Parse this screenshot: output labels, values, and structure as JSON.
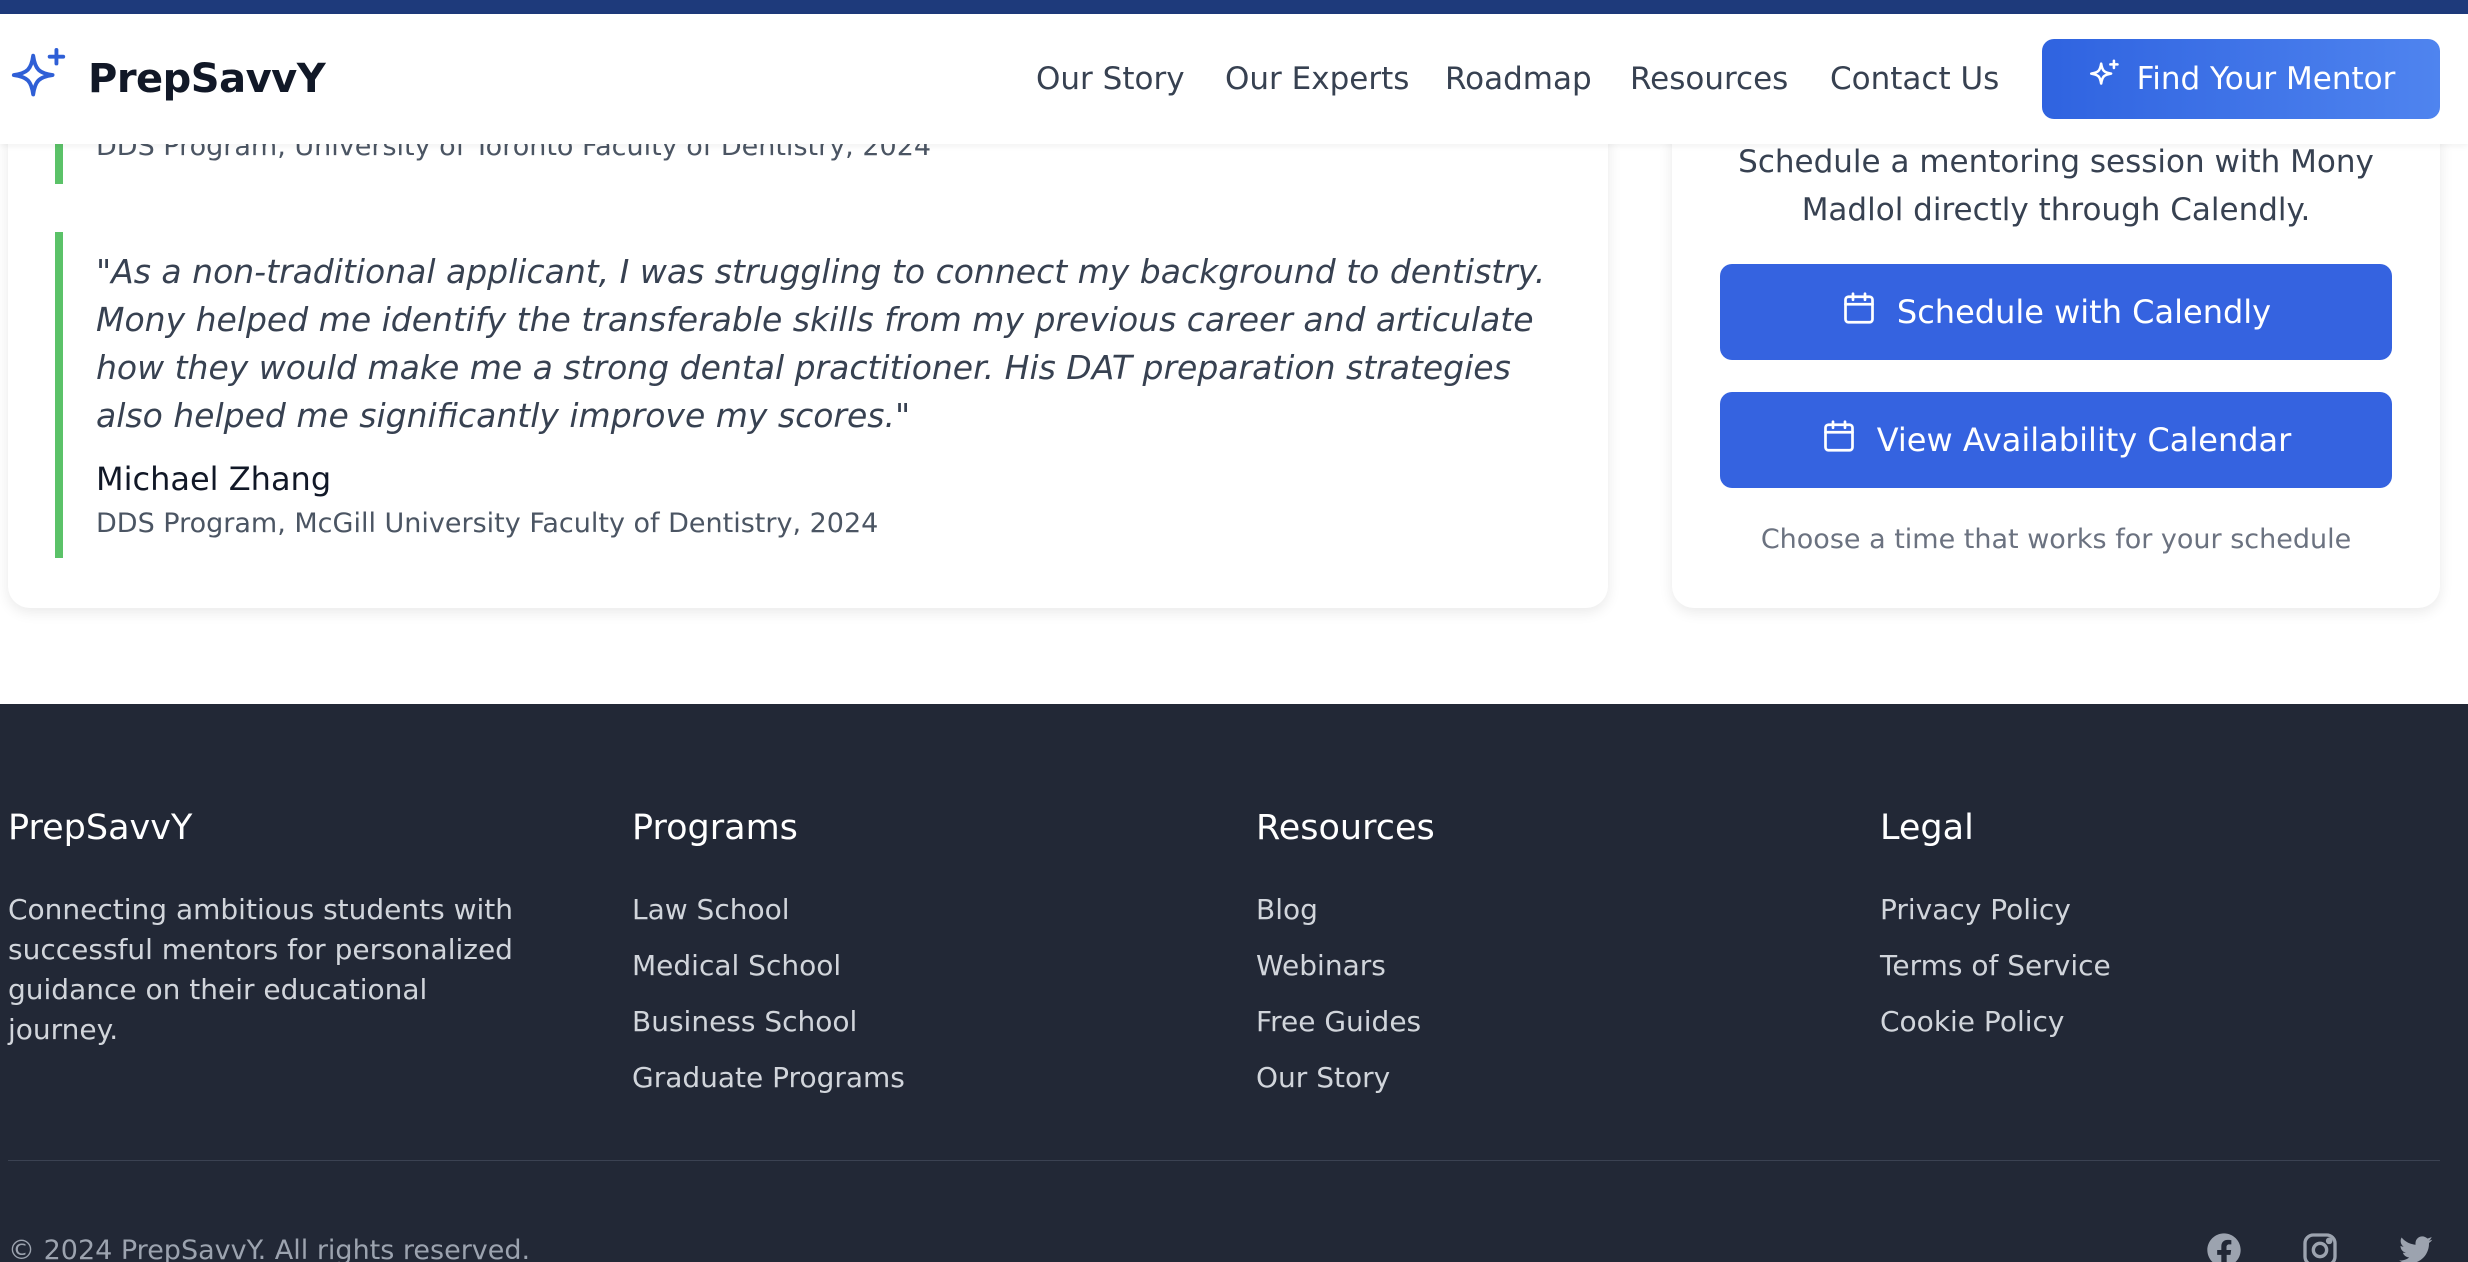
{
  "header": {
    "brand": "PrepSavvY",
    "nav": [
      "Our Story",
      "Our Experts",
      "Roadmap",
      "Resources",
      "Contact Us"
    ],
    "cta_label": "Find Your Mentor",
    "accent_color": "#1e3a7b",
    "cta_color": "#2f63e0"
  },
  "testimonials": [
    {
      "meta": "DDS Program, University of Toronto Faculty of Dentistry, 2024"
    },
    {
      "quote": "\"As a non-traditional applicant, I was struggling to connect my background to dentistry. Mony helped me identify the transferable skills from my previous career and articulate how they would make me a strong dental practitioner. His DAT preparation strategies also helped me significantly improve my scores.\"",
      "name": "Michael Zhang",
      "meta": "DDS Program, McGill University Faculty of Dentistry, 2024"
    }
  ],
  "booking": {
    "description": "Schedule a mentoring session with Mony Madlol directly through Calendly.",
    "schedule_button": "Schedule with Calendly",
    "availability_button": "View Availability Calendar",
    "note": "Choose a time that works for your schedule",
    "button_icon": "calendar-icon"
  },
  "footer": {
    "brand": {
      "title": "PrepSavvY",
      "description": "Connecting ambitious students with successful mentors for personalized guidance on their educational journey."
    },
    "programs": {
      "title": "Programs",
      "links": [
        "Law School",
        "Medical School",
        "Business School",
        "Graduate Programs"
      ]
    },
    "resources": {
      "title": "Resources",
      "links": [
        "Blog",
        "Webinars",
        "Free Guides",
        "Our Story"
      ]
    },
    "legal": {
      "title": "Legal",
      "links": [
        "Privacy Policy",
        "Terms of Service",
        "Cookie Policy"
      ]
    },
    "copyright": "© 2024 PrepSavvY. All rights reserved.",
    "social_icons": [
      "facebook-icon",
      "instagram-icon",
      "twitter-icon"
    ],
    "background_color": "#222836"
  }
}
